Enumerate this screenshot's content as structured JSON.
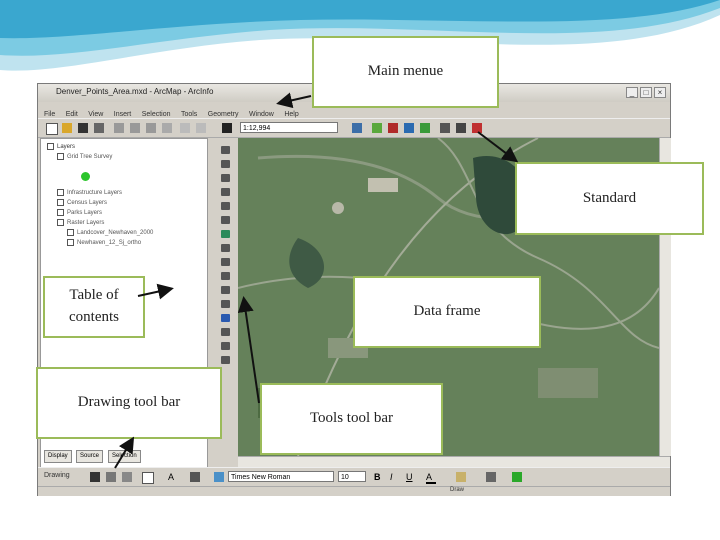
{
  "window": {
    "title": "Denver_Points_Area.mxd - ArcMap - ArcInfo",
    "menu": [
      "File",
      "Edit",
      "View",
      "Insert",
      "Selection",
      "Tools",
      "Geometry",
      "Window",
      "Help"
    ],
    "scale_value": "1:12,994",
    "toc": {
      "root": "Layers",
      "items": [
        "Grid Tree Survey",
        "Infrastructure Layers",
        "Census Layers",
        "Parks Layers",
        "Raster Layers",
        "Landcover_Newhaven_2000",
        "Newhaven_12_Sj_ortho"
      ]
    },
    "toc_tabs": [
      "Display",
      "Source",
      "Selection"
    ],
    "drawing_label": "Drawing",
    "font_value": "Times New Roman",
    "size_value": "10",
    "status_text": "Draw"
  },
  "callouts": {
    "main_menu": "Main menue",
    "standard": "Standard",
    "toc": "Table of contents",
    "data_frame": "Data frame",
    "drawing": "Drawing tool bar",
    "tools": "Tools tool bar"
  },
  "colors": {
    "callout_border": "#9bbb59",
    "map_base": "#5a7a4a"
  }
}
